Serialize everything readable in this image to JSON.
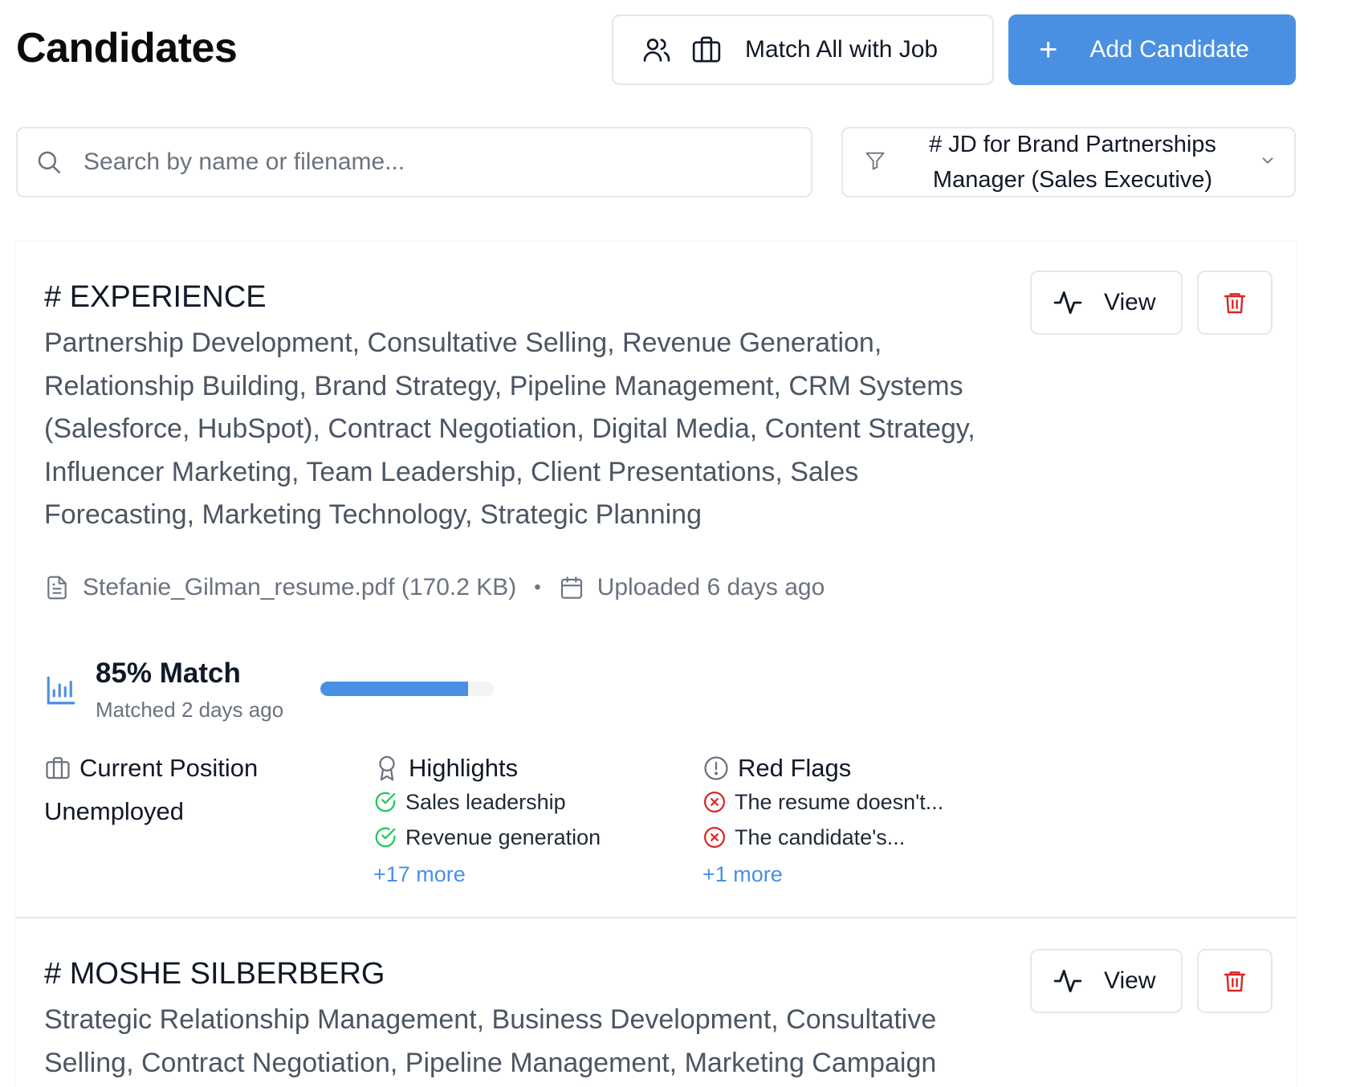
{
  "header": {
    "title": "Candidates",
    "match_all_label": "Match All with Job",
    "add_label": "Add Candidate"
  },
  "search": {
    "placeholder": "Search by name or filename...",
    "value": ""
  },
  "job_filter": {
    "selected": "# JD for Brand Partnerships Manager (Sales Executive)"
  },
  "colors": {
    "accent": "#4a90e2",
    "success": "#22c55e",
    "danger": "#dc2626"
  },
  "candidates": [
    {
      "title": "# EXPERIENCE",
      "summary": "Partnership Development, Consultative Selling, Revenue Generation, Relationship Building, Brand Strategy, Pipeline Management, CRM Systems (Salesforce, HubSpot), Contract Negotiation, Digital Media, Content Strategy, Influencer Marketing, Team Leadership, Client Presentations, Sales Forecasting, Marketing Technology, Strategic Planning",
      "filename": "Stefanie_Gilman_resume.pdf (170.2 KB)",
      "uploaded": "Uploaded 6 days ago",
      "match_label": "85% Match",
      "match_percent": 85,
      "matched": "Matched 2 days ago",
      "position_heading": "Current Position",
      "position": "Unemployed",
      "highlights_heading": "Highlights",
      "highlights": [
        "Sales leadership",
        "Revenue generation"
      ],
      "highlights_more": "+17 more",
      "redflags_heading": "Red Flags",
      "redflags": [
        "The resume doesn't...",
        "The candidate's..."
      ],
      "redflags_more": "+1 more",
      "view_label": "View"
    },
    {
      "title": "# MOSHE SILBERBERG",
      "summary": "Strategic Relationship Management, Business Development, Consultative Selling, Contract Negotiation, Pipeline Management, Marketing Campaign Strategy, Client Retention, Sales Presentation Development, CRM",
      "view_label": "View"
    }
  ]
}
